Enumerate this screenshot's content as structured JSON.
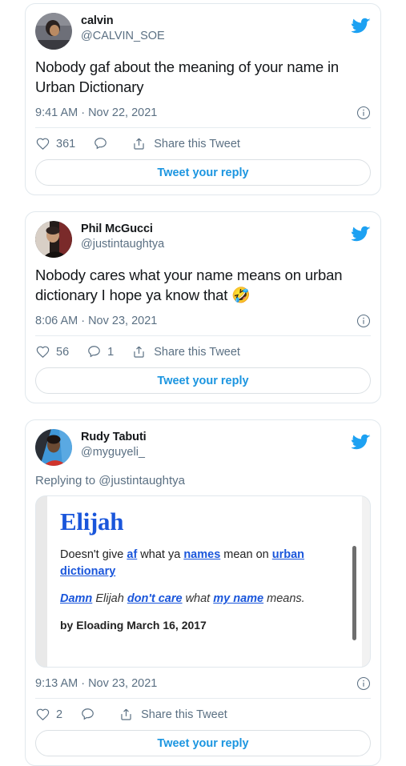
{
  "colors": {
    "twitter_blue": "#1DA1F2",
    "link_blue": "#1b95e0",
    "ud_blue": "#1a56db",
    "text_dark": "#14171a",
    "text_muted": "#5b7083",
    "card_border": "#e1e8ed"
  },
  "tweets": [
    {
      "display_name": "calvin",
      "handle": "@CALVIN_SOE",
      "text": "Nobody gaf about the meaning of your name in Urban Dictionary",
      "timestamp": "9:41 AM · Nov 22, 2021",
      "like_count": "361",
      "reply_count": "",
      "share_label": "Share this Tweet",
      "reply_button": "Tweet your reply",
      "bird_icon": "twitter-bird-icon",
      "info_icon": "info-circle-icon",
      "like_icon": "heart-icon",
      "comment_icon": "comment-icon",
      "share_icon": "share-icon"
    },
    {
      "display_name": "Phil McGucci",
      "handle": "@justintaughtya",
      "text": "Nobody cares what your name means on urban dictionary I hope ya know that ",
      "emoji": "🤣",
      "timestamp": "8:06 AM · Nov 23, 2021",
      "like_count": "56",
      "reply_count": "1",
      "share_label": "Share this Tweet",
      "reply_button": "Tweet your reply",
      "bird_icon": "twitter-bird-icon",
      "info_icon": "info-circle-icon",
      "like_icon": "heart-icon",
      "comment_icon": "comment-icon",
      "share_icon": "share-icon"
    },
    {
      "display_name": "Rudy Tabuti",
      "handle": "@myguyeli_",
      "replying_to": "Replying to @justintaughtya",
      "timestamp": "9:13 AM · Nov 23, 2021",
      "like_count": "2",
      "reply_count": "",
      "share_label": "Share this Tweet",
      "reply_button": "Tweet your reply",
      "bird_icon": "twitter-bird-icon",
      "info_icon": "info-circle-icon",
      "like_icon": "heart-icon",
      "comment_icon": "comment-icon",
      "share_icon": "share-icon",
      "embedded_image": {
        "source": "urban-dictionary-screenshot",
        "title": "Elijah",
        "definition_parts": [
          {
            "text": "Doesn't give ",
            "link": false
          },
          {
            "text": "af",
            "link": true
          },
          {
            "text": " what ya ",
            "link": false
          },
          {
            "text": "names",
            "link": true
          },
          {
            "text": " mean on ",
            "link": false
          },
          {
            "text": "urban dictionary",
            "link": true
          }
        ],
        "example_parts": [
          {
            "text": "Damn",
            "link": true
          },
          {
            "text": " Elijah ",
            "link": false
          },
          {
            "text": "don't care",
            "link": true
          },
          {
            "text": " what ",
            "link": false
          },
          {
            "text": "my name",
            "link": true
          },
          {
            "text": " means.",
            "link": false
          }
        ],
        "byline": "by Eloading March 16, 2017"
      }
    }
  ]
}
